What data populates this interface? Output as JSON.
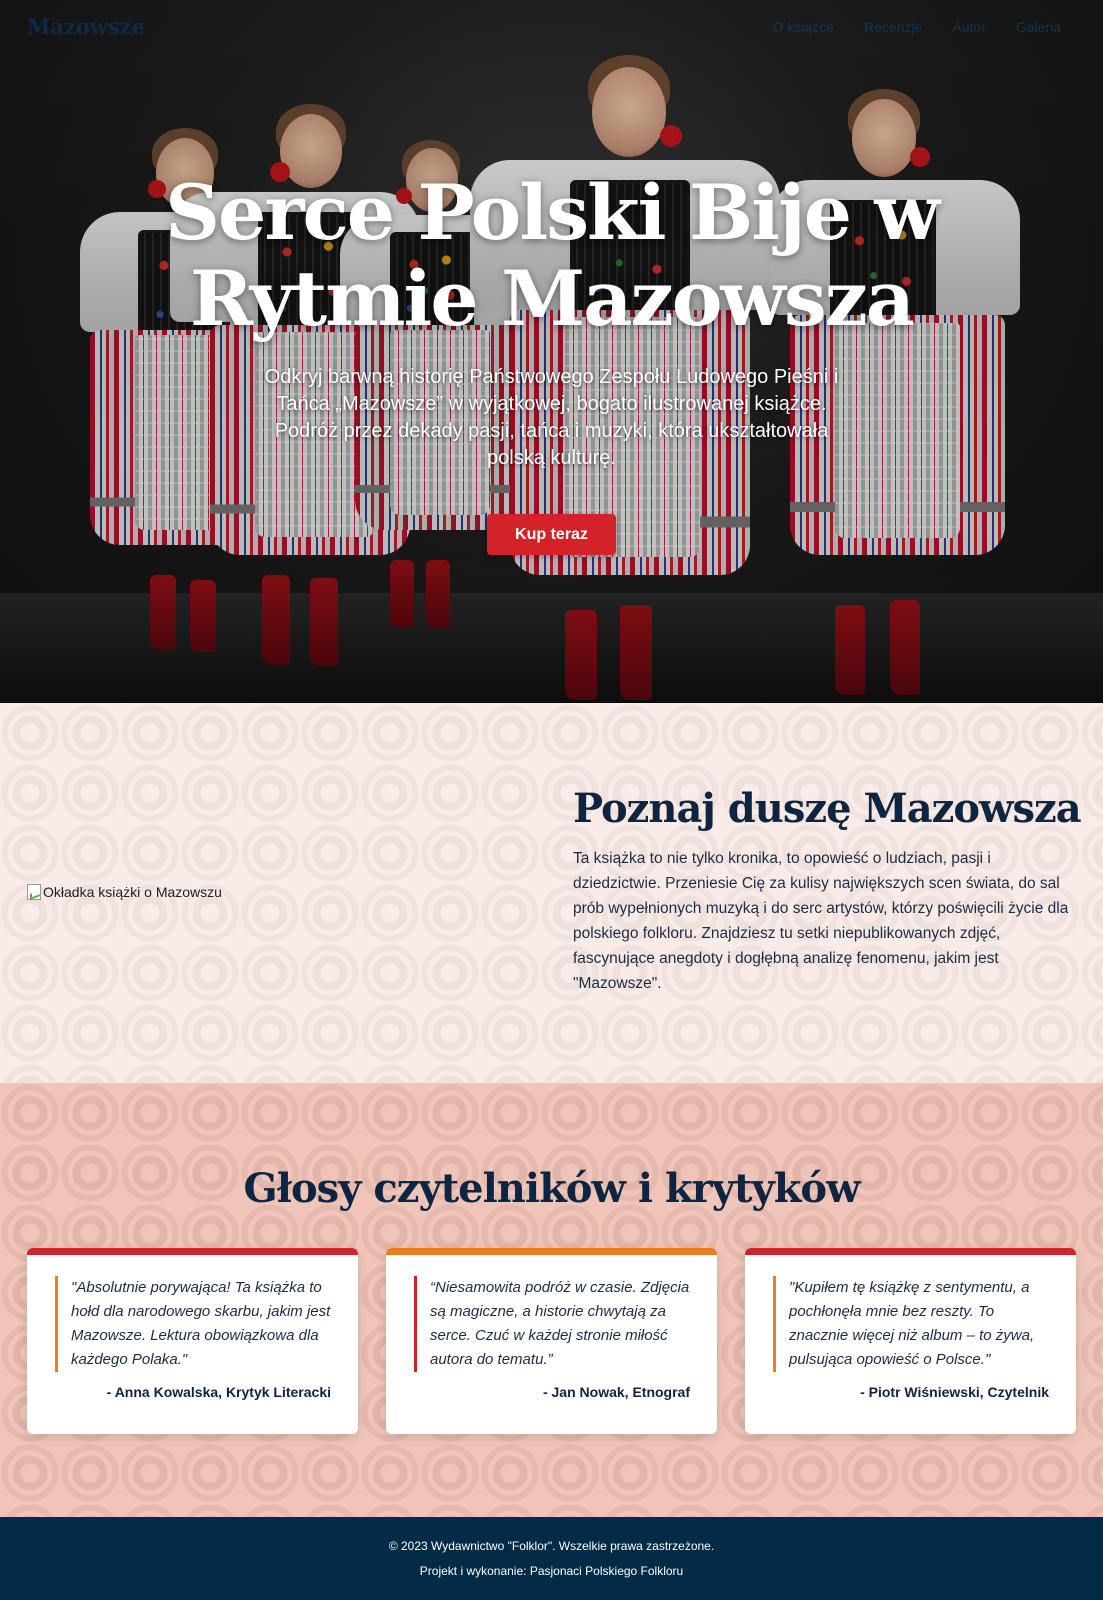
{
  "nav": {
    "logo": "Mazowsze",
    "links": [
      "O książce",
      "Recenzje",
      "Autor",
      "Galeria"
    ]
  },
  "hero": {
    "title": "Serce Polski Bije w Rytmie Mazowsza",
    "subtitle": "Odkryj barwną historię Państwowego Zespołu Ludowego Pieśni i Tańca „Mazowsze” w wyjątkowej, bogato ilustrowanej książce. Podróż przez dekady pasji, tańca i muzyki, która ukształtowała polską kulturę.",
    "cta": "Kup teraz"
  },
  "about": {
    "image_alt": "Okładka książki o Mazowszu",
    "title": "Poznaj duszę Mazowsza",
    "body": "Ta książka to nie tylko kronika, to opowieść o ludziach, pasji i dziedzictwie. Przeniesie Cię za kulisy największych scen świata, do sal prób wypełnionych muzyką i do serc artystów, którzy poświęcili życie dla polskiego folkloru. Znajdziesz tu setki niepublikowanych zdjęć, fascynujące anegdoty i dogłębną analizę fenomenu, jakim jest \"Mazowsze\"."
  },
  "reviews": {
    "title": "Głosy czytelników i krytyków",
    "items": [
      {
        "quote": "\"Absolutnie porywająca! Ta książka to hołd dla narodowego skarbu, jakim jest Mazowsze. Lektura obowiązkowa dla każdego Polaka.\"",
        "author": "- Anna Kowalska, Krytyk Literacki",
        "bar_color": "#d32328",
        "line_color": "#f07c1c"
      },
      {
        "quote": "“Niesamowita podróż w czasie. Zdjęcia są magiczne, a historie chwytają za serce. Czuć w każdej stronie miłość autora do tematu.”",
        "author": "- Jan Nowak, Etnograf",
        "bar_color": "#f07c1c",
        "line_color": "#d32328"
      },
      {
        "quote": "\"Kupiłem tę książkę z sentymentu, a pochłonęła mnie bez reszty. To znacznie więcej niż album – to żywa, pulsująca opowieść o Polsce.\"",
        "author": "- Piotr Wiśniewski, Czytelnik",
        "bar_color": "#d32328",
        "line_color": "#f07c1c"
      }
    ]
  },
  "footer": {
    "copyright": "© 2023 Wydawnictwo \"Folklor\". Wszelkie prawa zastrzeżone.",
    "credits": "Projekt i wykonanie: Pasjonaci Polskiego Folkloru"
  },
  "colors": {
    "accent_red": "#d32328",
    "accent_orange": "#f07c1c",
    "navy": "#0d2540",
    "footer_bg": "#022b47",
    "about_bg": "#f9ece7",
    "reviews_bg": "#efc5b9"
  }
}
